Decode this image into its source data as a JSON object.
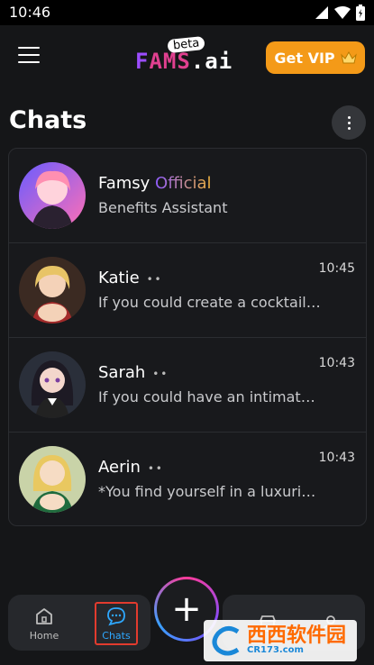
{
  "status_bar": {
    "time": "10:46"
  },
  "header": {
    "logo_f": "F",
    "logo_rest": "AMS",
    "logo_ai": ".ai",
    "logo_beta": "beta",
    "vip_label": "Get VIP",
    "crown_icon": "crown-icon"
  },
  "page": {
    "title": "Chats"
  },
  "chats": [
    {
      "name": "Famsy",
      "badge": "Official",
      "preview": "Benefits Assistant",
      "time": ""
    },
    {
      "name": "Katie",
      "preview": "If you could create a cocktail t...",
      "time": "10:45"
    },
    {
      "name": "Sarah",
      "preview": "If you could have an intimate c...",
      "time": "10:43"
    },
    {
      "name": "Aerin",
      "preview": "*You find yourself in a luxuriou...",
      "time": "10:43"
    }
  ],
  "nav": {
    "home_label": "Home",
    "chats_label": "Chats",
    "plus_label": "+"
  },
  "watermark": {
    "text": "西西软件园",
    "sub": "CR173.com"
  },
  "colors": {
    "accent_vip": "#f49a18",
    "nav_active": "#2ea8ff",
    "highlight_box": "#e23b2e"
  }
}
